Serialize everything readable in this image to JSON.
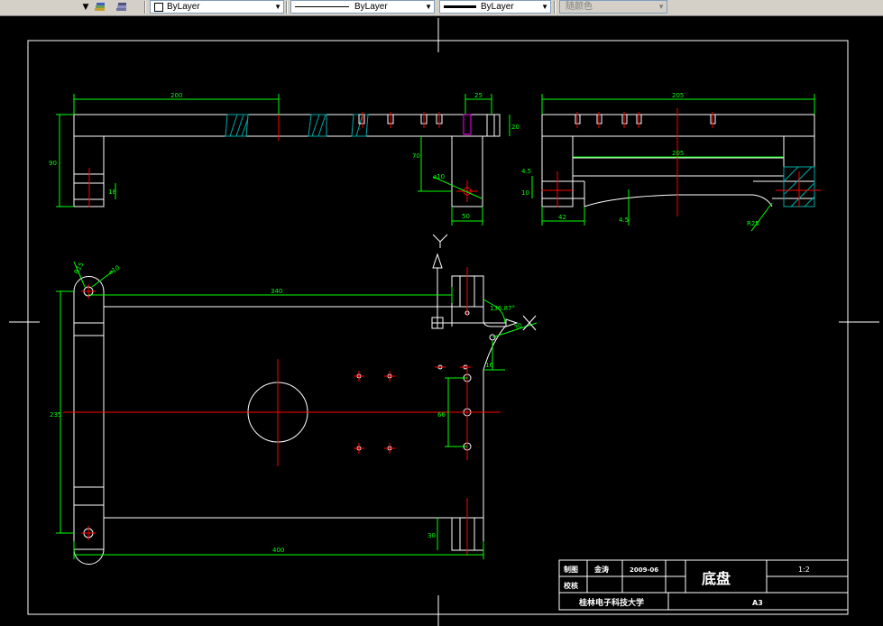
{
  "toolbar": {
    "layer_combo": "ByLayer",
    "linetype_combo": "ByLayer",
    "lineweight_combo": "ByLayer",
    "plotstyle_combo": "随颜色",
    "layers_icon": "layers-icon",
    "layer_states_icon": "layer-states-icon"
  },
  "dimensions": {
    "d200": "200",
    "d25": "25",
    "d20": "20",
    "d90": "90",
    "d18": "18",
    "d70": "70",
    "phi10_top": "⌀10",
    "d50": "50",
    "d205a": "205",
    "d205b": "205",
    "d45": "4.5",
    "d10": "10",
    "d42": "42",
    "d4_5b": "4.5",
    "r25": "R25",
    "r15": "R15",
    "phi10_left": "⌀10",
    "d340": "340",
    "ang": "136.87°",
    "d30": "30",
    "d16": "16",
    "d235": "235",
    "d66": "66",
    "d30b": "30",
    "d400": "400"
  },
  "title_block": {
    "draw_label": "制图",
    "designer": "金涛",
    "date": "2009-06",
    "check_label": "校核",
    "part_name": "底盘",
    "scale": "1:2",
    "school": "桂林电子科技大学",
    "sheet_size": "A3"
  },
  "colors": {
    "background": "#000000",
    "outline": "#ffffff",
    "dimension": "#00ff00",
    "centerline": "#ff0000",
    "hatch": "#00aaaa",
    "hidden": "#ff00ff"
  }
}
